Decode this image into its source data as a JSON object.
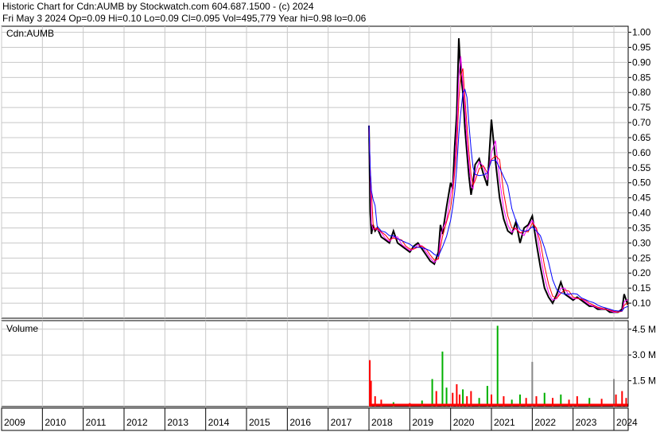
{
  "header": {
    "line1": "Historic Chart for Cdn:AUMB by Stockwatch.com 604.687.1500 - (c) 2024",
    "line2": "Fri May  3 2024   Op=0.09  Hi=0.10  Lo=0.09  Cl=0.095  Vol=495,779  Year hi=0.98  lo=0.06"
  },
  "price_panel": {
    "label": "Cdn:AUMB"
  },
  "volume_panel": {
    "label": "Volume"
  },
  "colors": {
    "price": "#000000",
    "ma_short": "#ff00ff",
    "ma_medium": "#ff0000",
    "ma_long": "#0000ff",
    "vol_up": "#00b000",
    "vol_down": "#ff0000",
    "vol_flat": "#888888",
    "grid": "#c8c8c8"
  },
  "chart_data": [
    {
      "type": "line",
      "title": "Cdn:AUMB",
      "ylim": [
        0.05,
        1.02
      ],
      "yticks": [
        "1.00",
        "0.95",
        "0.90",
        "0.85",
        "0.80",
        "0.75",
        "0.70",
        "0.65",
        "0.60",
        "0.55",
        "0.50",
        "0.45",
        "0.40",
        "0.35",
        "0.30",
        "0.25",
        "0.20",
        "0.15",
        "0.10"
      ],
      "xticks": [
        "2009",
        "2010",
        "2011",
        "2012",
        "2013",
        "2014",
        "2015",
        "2016",
        "2017",
        "2018",
        "2019",
        "2020",
        "2021",
        "2022",
        "2023",
        "2024"
      ],
      "xlim": [
        2009.0,
        2024.35
      ],
      "grid": true,
      "series": [
        {
          "x": [
            2018.0,
            2018.03,
            2018.06,
            2018.1,
            2018.15,
            2018.2,
            2018.3,
            2018.4,
            2018.5,
            2018.6,
            2018.7,
            2018.8,
            2018.9,
            2019.0,
            2019.1,
            2019.2,
            2019.3,
            2019.4,
            2019.5,
            2019.6,
            2019.7,
            2019.75,
            2019.8,
            2019.9,
            2020.0,
            2020.05,
            2020.1,
            2020.15,
            2020.2,
            2020.25,
            2020.3,
            2020.35,
            2020.4,
            2020.45,
            2020.5,
            2020.55,
            2020.6,
            2020.7,
            2020.8,
            2020.9,
            2021.0,
            2021.1,
            2021.2,
            2021.3,
            2021.4,
            2021.5,
            2021.6,
            2021.7,
            2021.8,
            2021.9,
            2022.0,
            2022.1,
            2022.2,
            2022.3,
            2022.4,
            2022.5,
            2022.6,
            2022.7,
            2022.8,
            2022.9,
            2023.0,
            2023.1,
            2023.2,
            2023.3,
            2023.4,
            2023.5,
            2023.6,
            2023.7,
            2023.8,
            2023.9,
            2024.0,
            2024.1,
            2024.2,
            2024.25,
            2024.34
          ],
          "y": [
            0.69,
            0.4,
            0.33,
            0.36,
            0.34,
            0.35,
            0.32,
            0.31,
            0.3,
            0.34,
            0.3,
            0.29,
            0.28,
            0.27,
            0.29,
            0.3,
            0.28,
            0.26,
            0.24,
            0.23,
            0.27,
            0.36,
            0.33,
            0.42,
            0.5,
            0.48,
            0.62,
            0.73,
            0.98,
            0.86,
            0.8,
            0.68,
            0.6,
            0.52,
            0.46,
            0.5,
            0.56,
            0.58,
            0.53,
            0.49,
            0.71,
            0.57,
            0.45,
            0.38,
            0.34,
            0.33,
            0.37,
            0.3,
            0.35,
            0.36,
            0.39,
            0.3,
            0.22,
            0.15,
            0.12,
            0.1,
            0.13,
            0.17,
            0.13,
            0.12,
            0.11,
            0.12,
            0.11,
            0.1,
            0.09,
            0.09,
            0.08,
            0.08,
            0.08,
            0.07,
            0.07,
            0.07,
            0.08,
            0.13,
            0.095
          ]
        }
      ]
    },
    {
      "type": "bar",
      "title": "Volume",
      "ylim": [
        0,
        5000000
      ],
      "yticks": [
        "4.5 M",
        "3.0 M",
        "1.5 M"
      ],
      "xlim": [
        2009.0,
        2024.35
      ],
      "x": [
        2018.02,
        2018.05,
        2018.15,
        2018.3,
        2018.6,
        2019.0,
        2019.3,
        2019.55,
        2019.65,
        2019.8,
        2019.9,
        2020.05,
        2020.15,
        2020.22,
        2020.3,
        2020.4,
        2020.5,
        2020.7,
        2020.9,
        2021.0,
        2021.15,
        2021.3,
        2021.5,
        2021.7,
        2021.85,
        2022.0,
        2022.1,
        2022.3,
        2022.5,
        2022.7,
        2022.9,
        2023.1,
        2023.4,
        2023.7,
        2024.0,
        2024.05,
        2024.2,
        2024.3
      ],
      "values": [
        2700000,
        1500000,
        600000,
        400000,
        250000,
        200000,
        350000,
        1600000,
        900000,
        3200000,
        1100000,
        800000,
        1300000,
        700000,
        1000000,
        600000,
        900000,
        500000,
        1200000,
        700000,
        4700000,
        600000,
        400000,
        700000,
        500000,
        2600000,
        600000,
        800000,
        500000,
        700000,
        400000,
        600000,
        500000,
        450000,
        1600000,
        700000,
        900000,
        500000
      ],
      "directions": [
        "down",
        "down",
        "down",
        "down",
        "up",
        "down",
        "up",
        "up",
        "down",
        "up",
        "up",
        "down",
        "down",
        "down",
        "up",
        "down",
        "down",
        "up",
        "up",
        "down",
        "up",
        "down",
        "up",
        "up",
        "down",
        "flat",
        "down",
        "up",
        "down",
        "up",
        "down",
        "down",
        "up",
        "down",
        "flat",
        "down",
        "down",
        "down"
      ]
    }
  ]
}
